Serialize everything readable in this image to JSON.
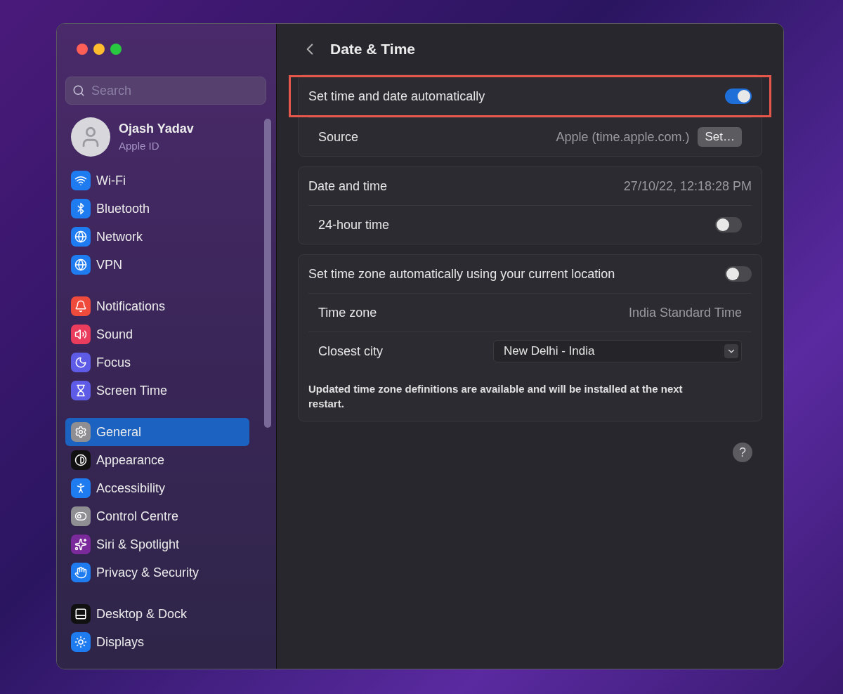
{
  "sidebar": {
    "search": {
      "placeholder": "Search"
    },
    "account": {
      "name": "Ojash Yadav",
      "subtitle": "Apple ID"
    },
    "groups": [
      {
        "items": [
          {
            "label": "Wi-Fi",
            "selected": false
          },
          {
            "label": "Bluetooth",
            "selected": false
          },
          {
            "label": "Network",
            "selected": false
          },
          {
            "label": "VPN",
            "selected": false
          }
        ]
      },
      {
        "items": [
          {
            "label": "Notifications",
            "selected": false
          },
          {
            "label": "Sound",
            "selected": false
          },
          {
            "label": "Focus",
            "selected": false
          },
          {
            "label": "Screen Time",
            "selected": false
          }
        ]
      },
      {
        "items": [
          {
            "label": "General",
            "selected": true
          },
          {
            "label": "Appearance",
            "selected": false
          },
          {
            "label": "Accessibility",
            "selected": false
          },
          {
            "label": "Control Centre",
            "selected": false
          },
          {
            "label": "Siri & Spotlight",
            "selected": false
          },
          {
            "label": "Privacy & Security",
            "selected": false
          }
        ]
      },
      {
        "items": [
          {
            "label": "Desktop & Dock",
            "selected": false
          },
          {
            "label": "Displays",
            "selected": false
          }
        ]
      }
    ]
  },
  "header": {
    "title": "Date & Time"
  },
  "sections": [
    {
      "rows": [
        {
          "kind": "toggle",
          "label": "Set time and date automatically",
          "on": true,
          "highlighted": true
        },
        {
          "kind": "value_button",
          "label": "Source",
          "value": "Apple (time.apple.com.)",
          "button": "Set…",
          "highlighted": false
        }
      ]
    },
    {
      "rows": [
        {
          "kind": "value",
          "label": "Date and time",
          "value": "27/10/22, 12:18:28 PM",
          "highlighted": false
        },
        {
          "kind": "toggle",
          "label": "24-hour time",
          "on": false,
          "highlighted": false
        }
      ]
    },
    {
      "rows": [
        {
          "kind": "toggle",
          "label": "Set time zone automatically using your current location",
          "on": false,
          "highlighted": false
        },
        {
          "kind": "value",
          "label": "Time zone",
          "value": "India Standard Time",
          "highlighted": false
        },
        {
          "kind": "select",
          "label": "Closest city",
          "value": "New Delhi - India",
          "highlighted": false
        },
        {
          "kind": "note",
          "label": "Updated time zone definitions are available and will be installed at the next restart.",
          "highlighted": false
        }
      ]
    }
  ],
  "help": {
    "label": "?"
  }
}
